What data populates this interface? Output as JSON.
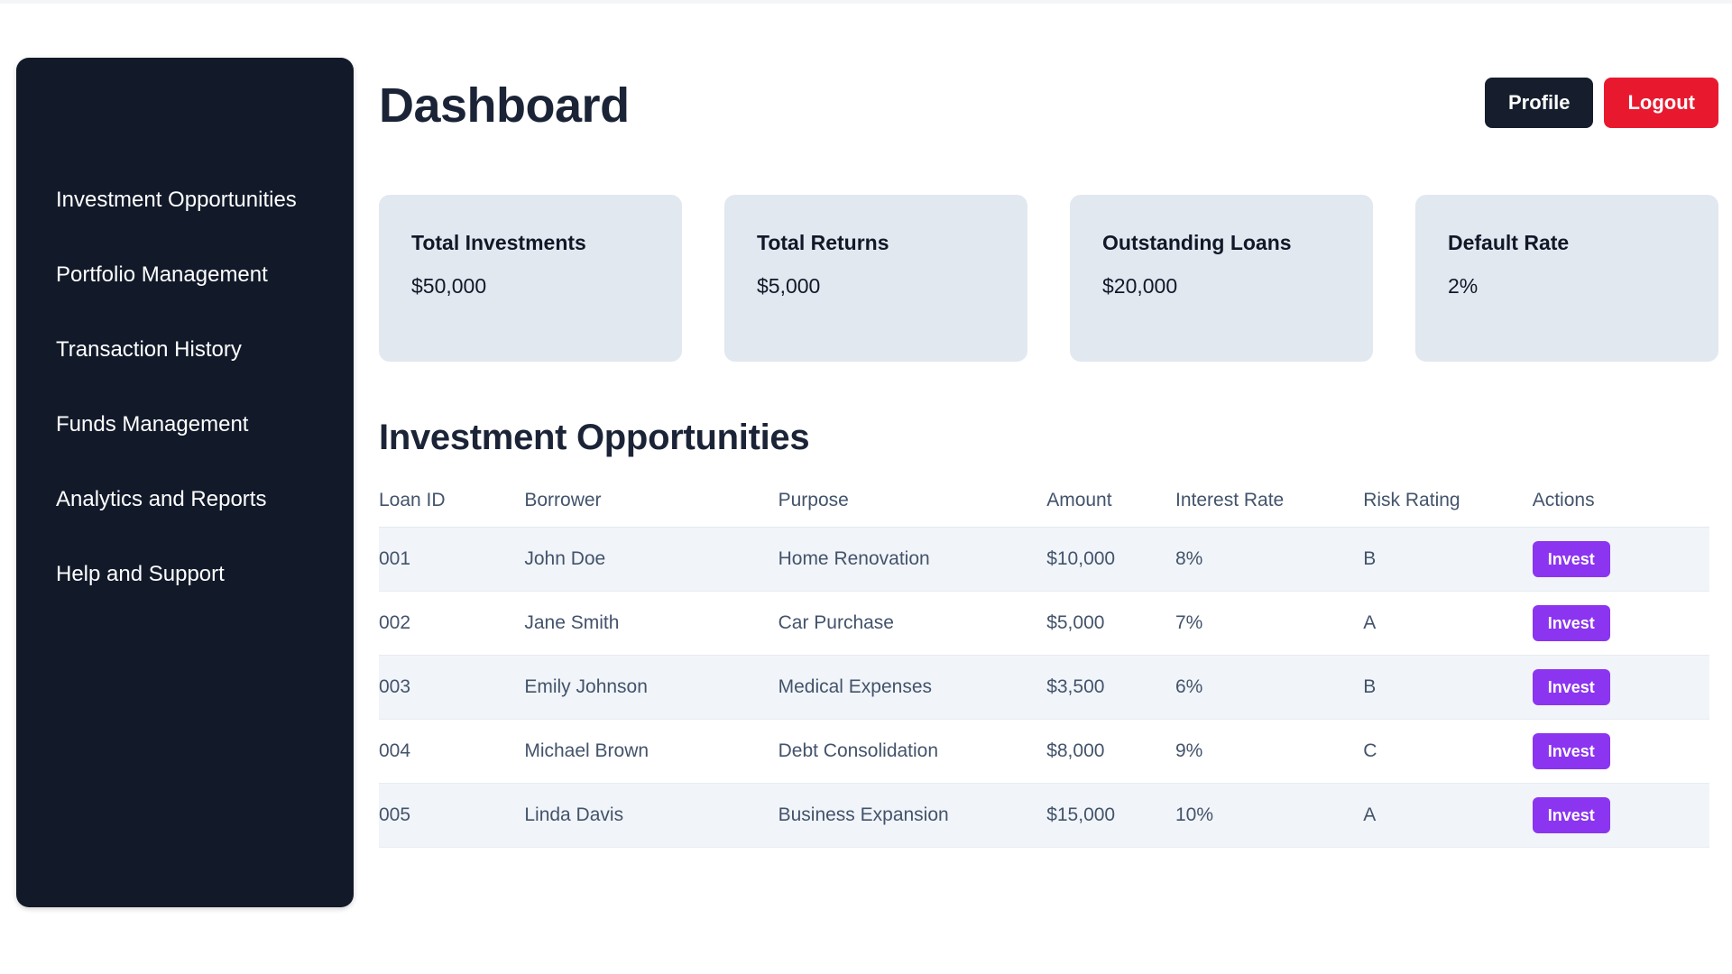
{
  "theme": {
    "sidebar_bg": "#121a2a",
    "card_bg": "#e2e8f0",
    "profile_btn": "#161e2e",
    "logout_btn": "#e8192f",
    "invest_btn": "#8b35f0",
    "row_stripe": "#f1f5f9",
    "text_dark": "#1b2437",
    "text_muted": "#43536b"
  },
  "sidebar": {
    "items": [
      {
        "label": "Investment Opportunities"
      },
      {
        "label": "Portfolio Management"
      },
      {
        "label": "Transaction History"
      },
      {
        "label": "Funds Management"
      },
      {
        "label": "Analytics and Reports"
      },
      {
        "label": "Help and Support"
      }
    ]
  },
  "header": {
    "title": "Dashboard",
    "profile_label": "Profile",
    "logout_label": "Logout"
  },
  "stats": [
    {
      "label": "Total Investments",
      "value": "$50,000"
    },
    {
      "label": "Total Returns",
      "value": "$5,000"
    },
    {
      "label": "Outstanding Loans",
      "value": "$20,000"
    },
    {
      "label": "Default Rate",
      "value": "2%"
    }
  ],
  "table": {
    "title": "Investment Opportunities",
    "columns": [
      "Loan ID",
      "Borrower",
      "Purpose",
      "Amount",
      "Interest Rate",
      "Risk Rating",
      "Actions"
    ],
    "action_label": "Invest",
    "rows": [
      {
        "loan_id": "001",
        "borrower": "John Doe",
        "purpose": "Home Renovation",
        "amount": "$10,000",
        "interest_rate": "8%",
        "risk_rating": "B",
        "action": "Invest"
      },
      {
        "loan_id": "002",
        "borrower": "Jane Smith",
        "purpose": "Car Purchase",
        "amount": "$5,000",
        "interest_rate": "7%",
        "risk_rating": "A",
        "action": "Invest"
      },
      {
        "loan_id": "003",
        "borrower": "Emily Johnson",
        "purpose": "Medical Expenses",
        "amount": "$3,500",
        "interest_rate": "6%",
        "risk_rating": "B",
        "action": "Invest"
      },
      {
        "loan_id": "004",
        "borrower": "Michael Brown",
        "purpose": "Debt Consolidation",
        "amount": "$8,000",
        "interest_rate": "9%",
        "risk_rating": "C",
        "action": "Invest"
      },
      {
        "loan_id": "005",
        "borrower": "Linda Davis",
        "purpose": "Business Expansion",
        "amount": "$15,000",
        "interest_rate": "10%",
        "risk_rating": "A",
        "action": "Invest"
      }
    ]
  }
}
